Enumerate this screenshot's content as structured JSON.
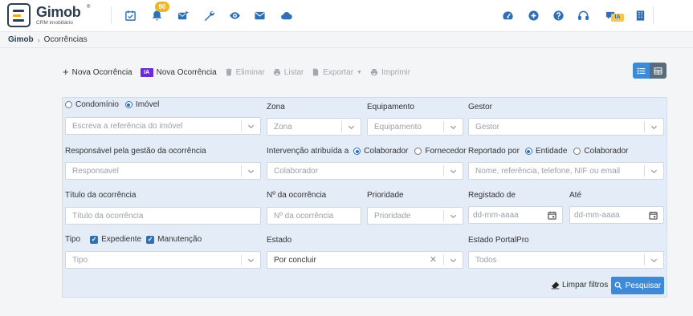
{
  "app": {
    "name": "Gimob",
    "registered": "®",
    "subtitle": "CRM imobiliário",
    "notification_count": "90",
    "ia_label": "IA"
  },
  "topbar_icons": [
    "calendar-check-icon",
    "bell-icon",
    "mail-send-icon",
    "wrench-icon",
    "eye-icon",
    "envelope-icon",
    "cloud-icon",
    "dashboard-icon",
    "plus-circle-icon",
    "help-icon",
    "headset-icon",
    "chat-ia-icon",
    "building-icon"
  ],
  "breadcrumb": {
    "root": "Gimob",
    "current": "Ocorrências"
  },
  "toolbar": {
    "new": "Nova Ocorrência",
    "ia_tag": "IA",
    "new_ia": "Nova Ocorrência",
    "delete": "Eliminar",
    "list": "Listar",
    "export": "Exportar",
    "print": "Imprimir"
  },
  "filters": {
    "property_type": {
      "option1": "Condomínio",
      "option2": "Imóvel",
      "selected": "Imóvel",
      "placeholder": "Escreva a referência do imóvel"
    },
    "zone": {
      "label": "Zona",
      "placeholder": "Zona"
    },
    "equipment": {
      "label": "Equipamento",
      "placeholder": "Equipamento"
    },
    "manager": {
      "label": "Gestor",
      "placeholder": "Gestor"
    },
    "responsible": {
      "label": "Responsável pela gestão da ocorrência",
      "placeholder": "Responsavel"
    },
    "intervention": {
      "label": "Intervenção atribuída a",
      "option1": "Colaborador",
      "option2": "Fornecedor",
      "selected": "Colaborador",
      "placeholder": "Colaborador"
    },
    "reported_by": {
      "label": "Reportado por",
      "option1": "Entidade",
      "option2": "Colaborador",
      "selected": "Entidade",
      "placeholder": "Nome, referência, telefone, NIF ou email"
    },
    "title": {
      "label": "Título da ocorrência",
      "placeholder": "Título da ocorrência"
    },
    "number": {
      "label": "Nº da ocorrência",
      "placeholder": "Nº da ocorrência"
    },
    "priority": {
      "label": "Prioridade",
      "placeholder": "Prioridade"
    },
    "registered_from": {
      "label": "Registado de",
      "placeholder": "dd-mm-aaaa"
    },
    "registered_to": {
      "label": "Até",
      "placeholder": "dd-mm-aaaa"
    },
    "type": {
      "label": "Tipo",
      "check1": "Expediente",
      "check2": "Manutenção",
      "placeholder": "Tipo"
    },
    "state": {
      "label": "Estado",
      "value": "Por concluir"
    },
    "portal_state": {
      "label": "Estado PortalPro",
      "placeholder": "Todos"
    }
  },
  "actions": {
    "clear": "Limpar filtros",
    "search": "Pesquisar"
  },
  "colors": {
    "primary": "#3d8ad8",
    "panel": "#e3ecf7",
    "badge": "#f0b429",
    "ia_purple": "#6c2bd9",
    "brand_dark": "#2d3e50"
  }
}
